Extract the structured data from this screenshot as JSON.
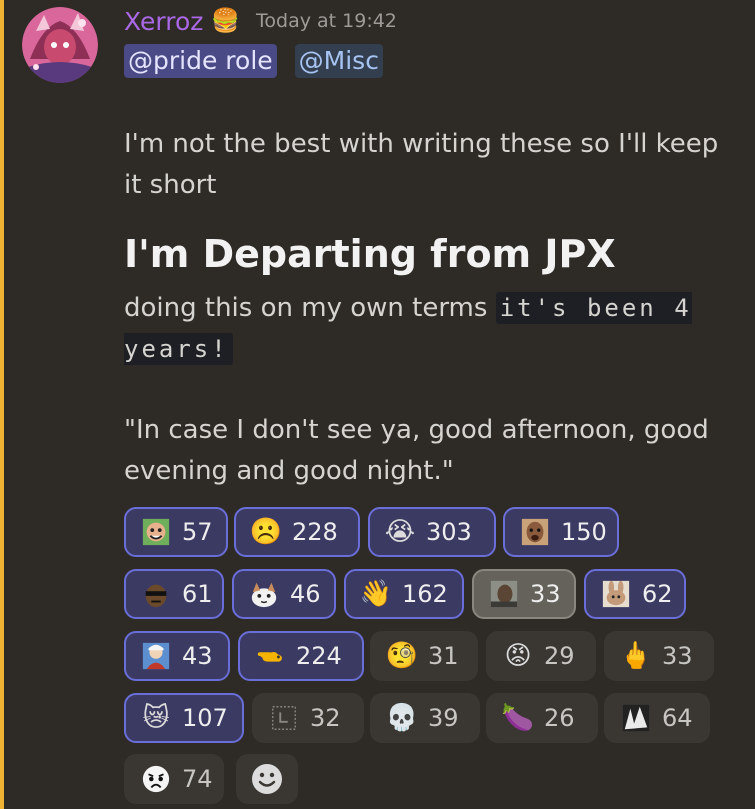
{
  "message": {
    "author": "Xerroz",
    "author_badge_emoji": "🍔",
    "author_color": "#a968e6",
    "timestamp": "Today at 19:42",
    "mentions": [
      {
        "label": "@pride role",
        "kind": "role"
      },
      {
        "label": "@Misc",
        "kind": "channel"
      }
    ],
    "paragraph1": "I'm not the best with writing these so I'll keep it short",
    "heading": "I'm Departing from JPX",
    "paragraph2_text": "doing this on my own terms ",
    "paragraph2_code": "it's been 4 years!",
    "paragraph3": "\"In case I don't see ya, good afternoon, good evening and good night.\""
  },
  "reactions": [
    {
      "icon": "custom-face-icon",
      "count": "57",
      "state": "mine"
    },
    {
      "icon": "frowning-face-icon",
      "glyph": "☹️",
      "count": "228",
      "state": "mine"
    },
    {
      "icon": "loudly-crying-face-icon",
      "glyph": "😭",
      "count": "303",
      "state": "mine"
    },
    {
      "icon": "custom-crying-person-icon",
      "count": "150",
      "state": "mine"
    },
    {
      "icon": "custom-sunglasses-face-icon",
      "count": "61",
      "state": "mine"
    },
    {
      "icon": "custom-cat-icon",
      "count": "46",
      "state": "mine"
    },
    {
      "icon": "waving-hand-icon",
      "glyph": "👋",
      "count": "162",
      "state": "mine"
    },
    {
      "icon": "custom-photo-person-icon",
      "count": "33",
      "state": "highlighted"
    },
    {
      "icon": "custom-rabbit-icon",
      "count": "62",
      "state": "mine"
    },
    {
      "icon": "custom-anime-character-icon",
      "count": "43",
      "state": "mine"
    },
    {
      "icon": "custom-pointing-hand-icon",
      "count": "224",
      "state": "mine"
    },
    {
      "icon": "face-with-monocle-icon",
      "glyph": "🧐",
      "count": "31",
      "state": "default"
    },
    {
      "icon": "enraged-face-icon",
      "glyph": "😡",
      "count": "29",
      "state": "default"
    },
    {
      "icon": "middle-finger-icon",
      "glyph": "🖕",
      "count": "33",
      "state": "default"
    },
    {
      "icon": "crying-cat-face-icon",
      "glyph": "😿",
      "count": "107",
      "state": "mine"
    },
    {
      "icon": "custom-loss-icon",
      "count": "32",
      "state": "default"
    },
    {
      "icon": "skull-icon",
      "glyph": "💀",
      "count": "39",
      "state": "default"
    },
    {
      "icon": "eggplant-icon",
      "glyph": "🍆",
      "count": "26",
      "state": "default"
    },
    {
      "icon": "custom-bw-image-icon",
      "count": "64",
      "state": "default"
    },
    {
      "icon": "custom-sad-face-icon",
      "count": "74",
      "state": "default"
    }
  ],
  "add_reaction_icon": "add-reaction-smiley-icon",
  "colors": {
    "accent_bar": "#f0b232",
    "background": "#2e2a25",
    "reaction_mine_border": "#6a6ed8",
    "role_mention_bg": "#4a4a86"
  }
}
